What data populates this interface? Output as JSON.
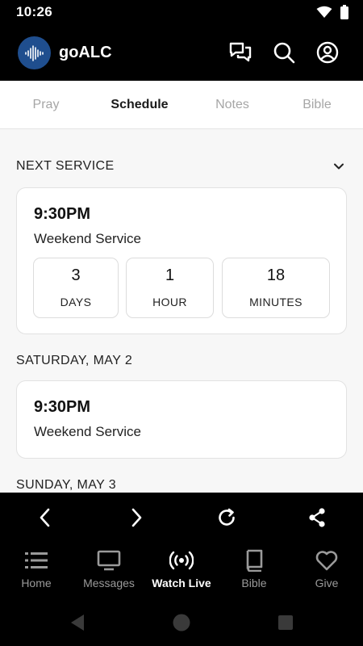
{
  "status_bar": {
    "time": "10:26",
    "icons": [
      "wifi-icon",
      "battery-icon"
    ]
  },
  "header": {
    "title": "goALC",
    "icons": [
      "chat-icon",
      "search-icon",
      "account-icon"
    ]
  },
  "tabs": [
    {
      "label": "Pray",
      "active": false
    },
    {
      "label": "Schedule",
      "active": true
    },
    {
      "label": "Notes",
      "active": false
    },
    {
      "label": "Bible",
      "active": false
    }
  ],
  "next_service": {
    "heading": "NEXT SERVICE",
    "time": "9:30PM",
    "name": "Weekend Service",
    "countdown": [
      {
        "value": "3",
        "unit": "DAYS"
      },
      {
        "value": "1",
        "unit": "HOUR"
      },
      {
        "value": "18",
        "unit": "MINUTES"
      }
    ]
  },
  "schedule": [
    {
      "date": "SATURDAY, MAY 2",
      "time": "9:30PM",
      "name": "Weekend Service"
    },
    {
      "date": "SUNDAY, MAY 3"
    }
  ],
  "browser_controls": [
    "back-icon",
    "forward-icon",
    "refresh-icon",
    "share-icon"
  ],
  "bottom_nav": [
    {
      "label": "Home",
      "icon": "list-icon",
      "active": false
    },
    {
      "label": "Messages",
      "icon": "tv-icon",
      "active": false
    },
    {
      "label": "Watch Live",
      "icon": "broadcast-icon",
      "active": true
    },
    {
      "label": "Bible",
      "icon": "book-icon",
      "active": false
    },
    {
      "label": "Give",
      "icon": "heart-icon",
      "active": false
    }
  ],
  "colors": {
    "logo_bg": "#1f4e8e",
    "background": "#f7f7f7",
    "bar": "#000000",
    "inactive": "#9a9a9a"
  }
}
